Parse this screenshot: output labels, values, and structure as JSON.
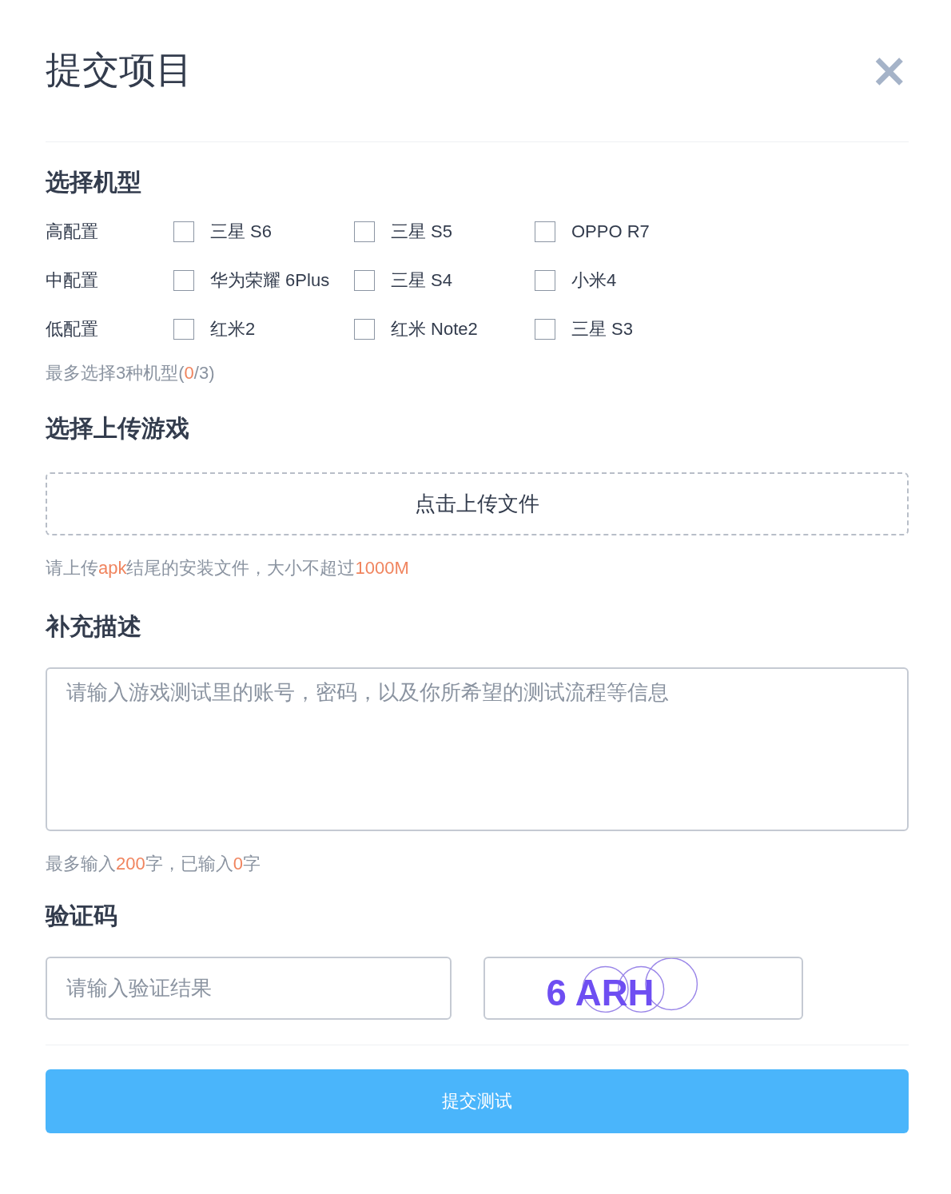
{
  "dialog": {
    "title": "提交项目",
    "close": "×"
  },
  "models": {
    "heading": "选择机型",
    "groups": [
      {
        "label": "高配置",
        "options": [
          {
            "label": "三星 S6",
            "checked": false
          },
          {
            "label": "三星 S5",
            "checked": false
          },
          {
            "label": "OPPO R7",
            "checked": false
          }
        ]
      },
      {
        "label": "中配置",
        "options": [
          {
            "label": "华为荣耀 6Plus",
            "checked": false
          },
          {
            "label": "三星 S4",
            "checked": false
          },
          {
            "label": "小米4",
            "checked": false
          }
        ]
      },
      {
        "label": "低配置",
        "options": [
          {
            "label": "红米2",
            "checked": false
          },
          {
            "label": "红米 Note2",
            "checked": false
          },
          {
            "label": "三星 S3",
            "checked": false
          }
        ]
      }
    ],
    "hint": [
      {
        "text": "最多选择3种机型(",
        "highlight": false
      },
      {
        "text": "0",
        "highlight": true
      },
      {
        "text": "/3)",
        "highlight": false
      }
    ]
  },
  "upload": {
    "heading": "选择上传游戏",
    "button": "点击上传文件",
    "hint": [
      {
        "text": "请上传",
        "highlight": false
      },
      {
        "text": "apk",
        "highlight": true
      },
      {
        "text": "结尾的安装文件，大小不超过",
        "highlight": false
      },
      {
        "text": "1000M",
        "highlight": true
      }
    ]
  },
  "description": {
    "heading": "补充描述",
    "placeholder": "请输入游戏测试里的账号，密码，以及你所希望的测试流程等信息",
    "hint": [
      {
        "text": "最多输入",
        "highlight": false
      },
      {
        "text": "200",
        "highlight": true
      },
      {
        "text": "字，已输入",
        "highlight": false
      },
      {
        "text": "0",
        "highlight": true
      },
      {
        "text": "字",
        "highlight": false
      }
    ]
  },
  "captcha": {
    "heading": "验证码",
    "placeholder": "请输入验证结果",
    "code": "6 ARH"
  },
  "submit": "提交测试"
}
